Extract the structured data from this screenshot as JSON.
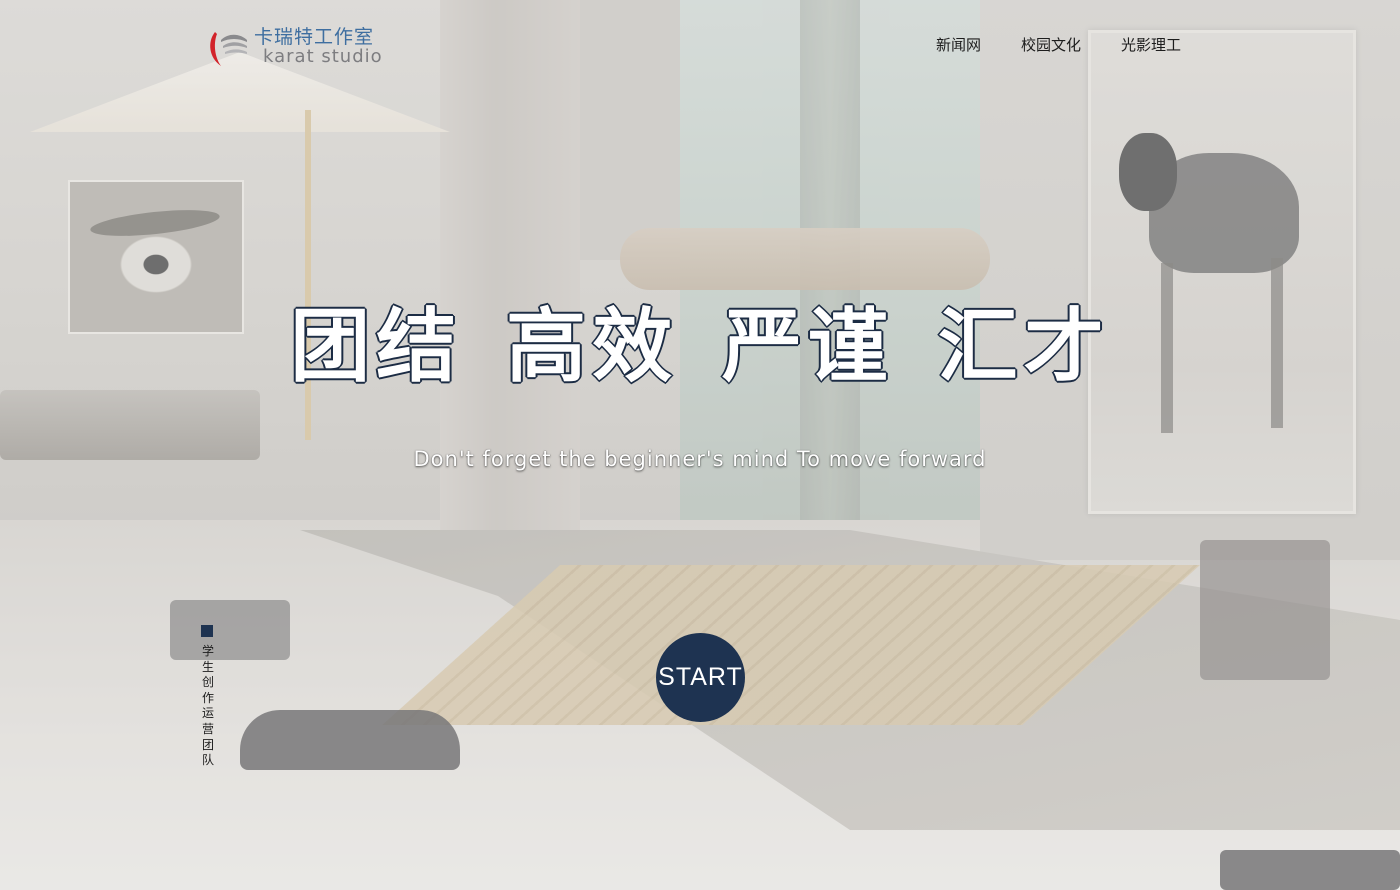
{
  "logo": {
    "cn": "卡瑞特工作室",
    "en": "karat studio",
    "brand_color": "#3e6ea0",
    "accent_color": "#d2232a"
  },
  "nav": {
    "items": [
      {
        "label": "新闻网"
      },
      {
        "label": "校园文化"
      },
      {
        "label": "光影理工"
      }
    ]
  },
  "hero": {
    "headline": "团结 高效 严谨 汇才",
    "tagline": "Don't forget the beginner's mind To move forward",
    "start_label": "START",
    "button_color": "#1e3351"
  },
  "side": {
    "label": "学生创作运营团队"
  }
}
